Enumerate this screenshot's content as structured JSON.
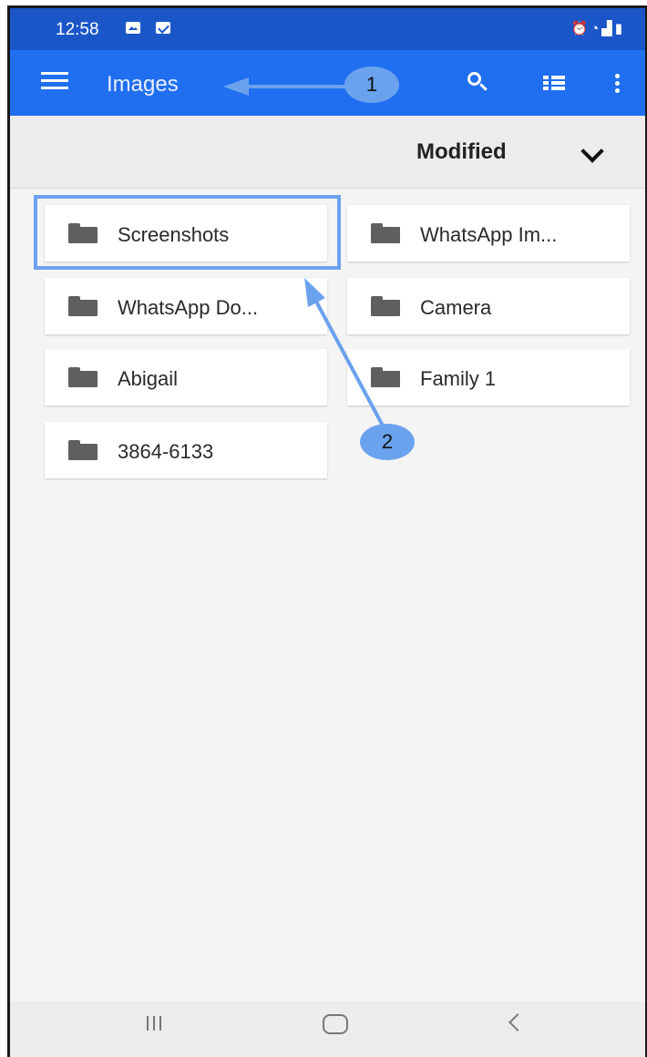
{
  "status_bar": {
    "time": "12:58",
    "left_icons": [
      "gallery-icon",
      "message-icon"
    ],
    "right_icons": [
      "alarm-icon",
      "wifi-icon",
      "signal-icon",
      "battery-icon"
    ]
  },
  "app_bar": {
    "title": "Images",
    "icons": [
      "menu-icon",
      "search-icon",
      "list-view-icon",
      "more-vert-icon"
    ],
    "color": "#1f6ff0",
    "status_color": "#1a56c8"
  },
  "sort": {
    "label": "Modified",
    "icon": "chevron-down-icon"
  },
  "folders": [
    {
      "label": "Screenshots"
    },
    {
      "label": "WhatsApp Im..."
    },
    {
      "label": "WhatsApp Do..."
    },
    {
      "label": "Camera"
    },
    {
      "label": "Abigail"
    },
    {
      "label": "Family 1"
    },
    {
      "label": "3864-6133"
    }
  ],
  "annotations": {
    "step1": "1",
    "step2": "2",
    "accent": "#6ba2ee"
  },
  "nav_bar": {
    "icons": [
      "recent-apps-icon",
      "home-icon",
      "back-icon"
    ]
  }
}
